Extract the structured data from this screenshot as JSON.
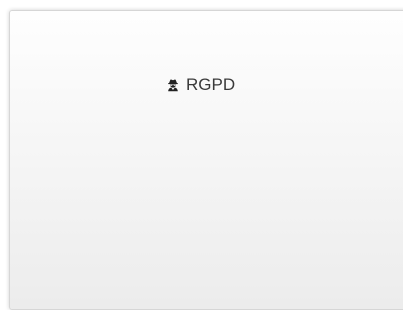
{
  "panel": {
    "title": "RGPD",
    "icon": "user-secret-icon"
  }
}
